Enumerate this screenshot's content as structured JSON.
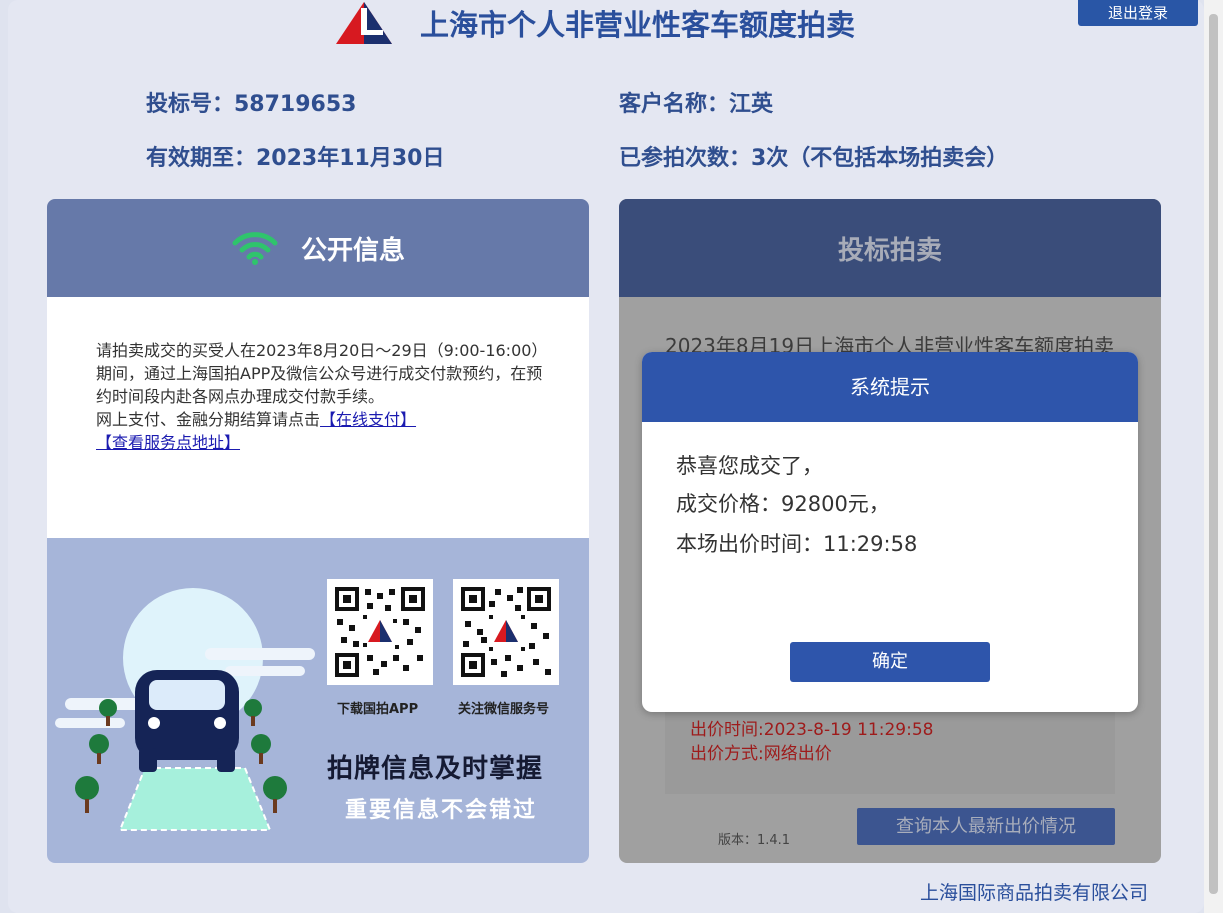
{
  "header": {
    "title": "上海市个人非营业性客车额度拍卖",
    "logout_label": "退出登录"
  },
  "user_info": {
    "bid_number": "投标号：58719653",
    "customer_name": "客户名称：江英",
    "valid_until": "有效期至：2023年11月30日",
    "participation_count": "已参拍次数：3次（不包括本场拍卖会）"
  },
  "public_info": {
    "title": "公开信息",
    "notice_text": "请拍卖成交的买受人在2023年8月20日～29日（9:00-16:00）期间，通过上海国拍APP及微信公众号进行成交付款预约，在预约时间段内赴各网点办理成交付款手续。",
    "payment_text": "网上支付、金融分期结算请点击",
    "online_pay_link": "【在线支付】",
    "service_points_link": "【查看服务点地址】"
  },
  "promo": {
    "qr_app_caption": "下载国拍APP",
    "qr_wechat_caption": "关注微信服务号",
    "headline": "拍牌信息及时掌握",
    "subline": "重要信息不会错过"
  },
  "bidding": {
    "title": "投标拍卖",
    "auction_title": "2023年8月19日上海市个人非营业性客车额度拍卖",
    "bid_time": "出价时间:2023-8-19 11:29:58",
    "bid_method": "出价方式:网络出价",
    "version": "版本：1.4.1",
    "query_button": "查询本人最新出价情况"
  },
  "dialog": {
    "title": "系统提示",
    "line1": "恭喜您成交了，",
    "line2": "成交价格：92800元，",
    "line3": "本场出价时间：11:29:58",
    "ok_label": "确定"
  },
  "footer": {
    "company": "上海国际商品拍卖有限公司"
  },
  "colors": {
    "brand_blue": "#2a4f9c",
    "dialog_blue": "#2e55ab",
    "bid_red": "#9e1b1b",
    "wifi_green": "#2fc46c"
  },
  "icons": {
    "logo": "red-blue-triangle-logo",
    "signal": "wifi-icon",
    "qr": "qr-code-icon"
  }
}
